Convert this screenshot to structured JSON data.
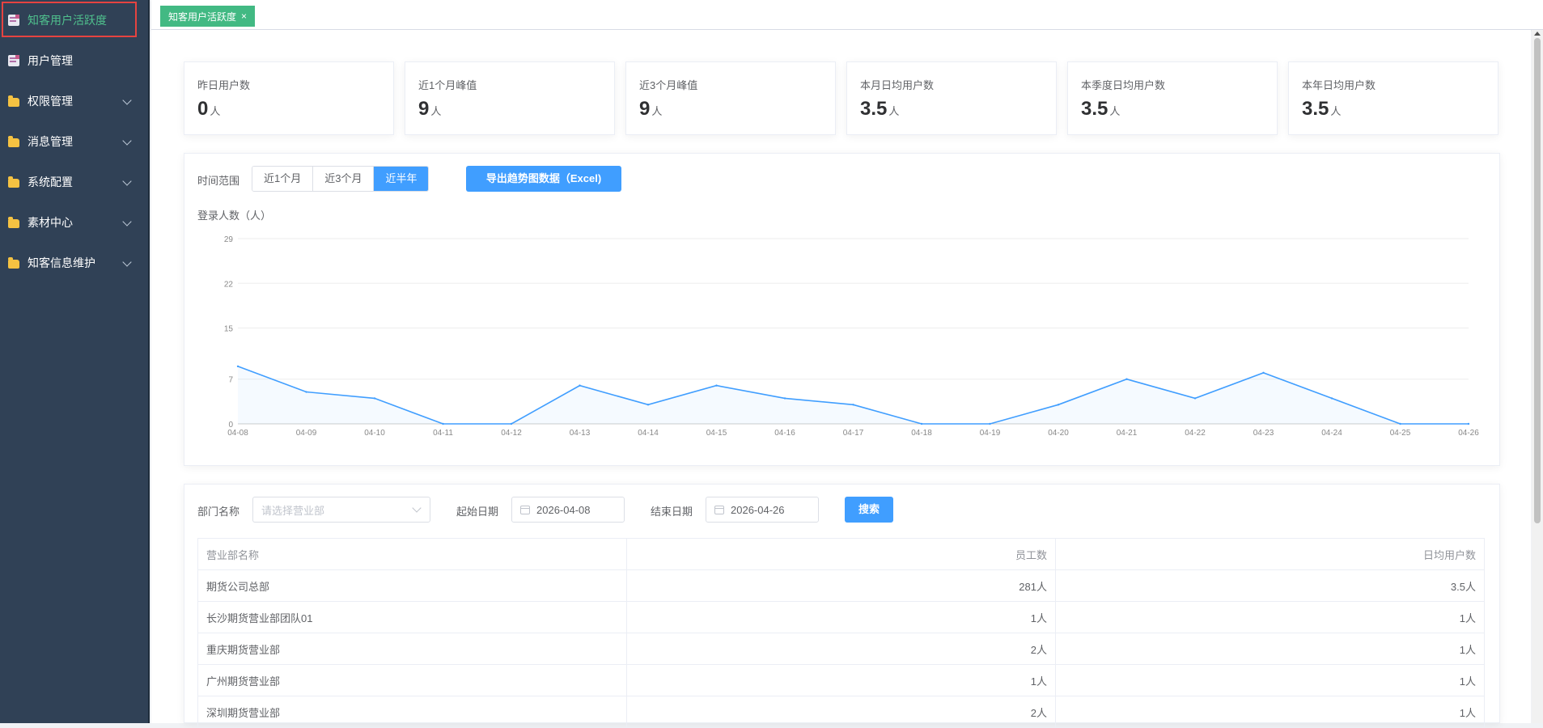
{
  "sidebar": {
    "items": [
      {
        "label": "知客用户活跃度",
        "icon": "document-icon",
        "active": true,
        "expandable": false
      },
      {
        "label": "用户管理",
        "icon": "document-icon",
        "active": false,
        "expandable": false
      },
      {
        "label": "权限管理",
        "icon": "folder-icon",
        "active": false,
        "expandable": true
      },
      {
        "label": "消息管理",
        "icon": "folder-icon",
        "active": false,
        "expandable": true
      },
      {
        "label": "系统配置",
        "icon": "folder-icon",
        "active": false,
        "expandable": true
      },
      {
        "label": "素材中心",
        "icon": "folder-icon",
        "active": false,
        "expandable": true
      },
      {
        "label": "知客信息维护",
        "icon": "folder-icon",
        "active": false,
        "expandable": true
      }
    ]
  },
  "tags": [
    {
      "label": "知客用户活跃度",
      "close": "×"
    }
  ],
  "stats": [
    {
      "title": "昨日用户数",
      "value": "0",
      "unit": "人"
    },
    {
      "title": "近1个月峰值",
      "value": "9",
      "unit": "人"
    },
    {
      "title": "近3个月峰值",
      "value": "9",
      "unit": "人"
    },
    {
      "title": "本月日均用户数",
      "value": "3.5",
      "unit": "人"
    },
    {
      "title": "本季度日均用户数",
      "value": "3.5",
      "unit": "人"
    },
    {
      "title": "本年日均用户数",
      "value": "3.5",
      "unit": "人"
    }
  ],
  "trend": {
    "range_label": "时间范围",
    "ranges": [
      "近1个月",
      "近3个月",
      "近半年"
    ],
    "selected_range": "近半年",
    "export_label": "导出趋势图数据（Excel)",
    "chart_title": "登录人数（人）"
  },
  "chart_data": {
    "type": "area",
    "title": "登录人数（人）",
    "categories": [
      "04-08",
      "04-09",
      "04-10",
      "04-11",
      "04-12",
      "04-13",
      "04-14",
      "04-15",
      "04-16",
      "04-17",
      "04-18",
      "04-19",
      "04-20",
      "04-21",
      "04-22",
      "04-23",
      "04-24",
      "04-25",
      "04-26"
    ],
    "values": [
      9,
      5,
      4,
      0,
      0,
      6,
      3,
      6,
      4,
      3,
      0,
      0,
      3,
      7,
      4,
      8,
      4,
      0,
      0
    ],
    "yticks": [
      0,
      7,
      15,
      22,
      29
    ],
    "ylim": [
      0,
      29
    ],
    "grid": true,
    "color": "#409eff"
  },
  "filter": {
    "dept_label": "部门名称",
    "dept_placeholder": "请选择营业部",
    "start_label": "起始日期",
    "start_value": "2026-04-08",
    "end_label": "结束日期",
    "end_value": "2026-04-26",
    "search_label": "搜索"
  },
  "table": {
    "headers": [
      "营业部名称",
      "员工数",
      "日均用户数"
    ],
    "rows": [
      [
        "期货公司总部",
        "281人",
        "3.5人"
      ],
      [
        "长沙期货营业部团队01",
        "1人",
        "1人"
      ],
      [
        "重庆期货营业部",
        "2人",
        "1人"
      ],
      [
        "广州期货营业部",
        "1人",
        "1人"
      ],
      [
        "深圳期货营业部",
        "2人",
        "1人"
      ]
    ]
  },
  "colors": {
    "sidebar_bg": "#304156",
    "accent": "#409eff",
    "tag": "#42b983",
    "active_text": "#4fc08d"
  }
}
